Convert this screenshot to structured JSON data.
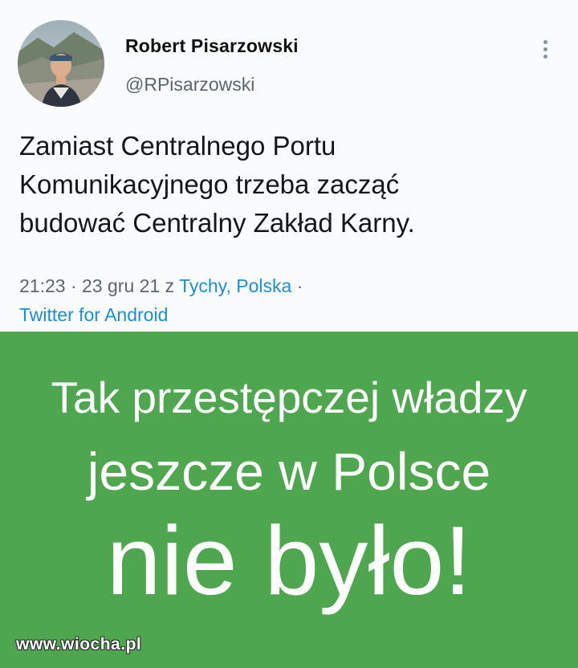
{
  "tweet": {
    "author_name": "Robert Pisarzowski",
    "author_handle": "@RPisarzowski",
    "text_line1": "Zamiast Centralnego Portu",
    "text_line2": "Komunikacyjnego trzeba zacząć",
    "text_line3": "budować Centralny Zakład Karny.",
    "time": "21:23",
    "date": "23 gru 21",
    "location_prefix": "z",
    "location": "Tychy, Polska",
    "source": "Twitter for Android",
    "more_icon": "more-vertical-icon"
  },
  "banner": {
    "line1": "Tak przestępczej władzy",
    "line2": "jeszcze w Polsce",
    "line3": "nie było!",
    "background": "#4ea74e",
    "text_color": "#ffffff"
  },
  "watermark": "www.wiocha.pl",
  "colors": {
    "link": "#1b8fd6",
    "secondary_text": "#5b6670",
    "primary_text": "#14171a"
  }
}
